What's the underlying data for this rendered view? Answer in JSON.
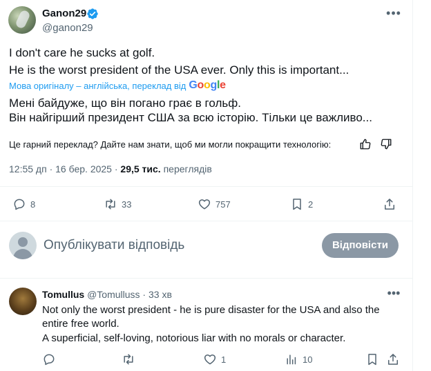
{
  "author": {
    "name": "Ganon29",
    "handle": "@ganon29",
    "verified": true
  },
  "post": {
    "original_lines": [
      "I don't care he sucks at golf.",
      "He is the worst president of the USA ever. Only this is important..."
    ],
    "translation_note": "Мова оригіналу – англійська, переклад від",
    "google_letters": [
      "G",
      "o",
      "o",
      "g",
      "l",
      "e"
    ],
    "translated_lines": [
      "Мені байдуже, що він погано грає в гольф.",
      "Він найгірший президент США за всю історію. Тільки це важливо..."
    ],
    "feedback_prompt": "Це гарний переклад? Дайте нам знати, щоб ми могли покращити технологію:",
    "time": "12:55 дп",
    "date": "16 бер. 2025",
    "views_count": "29,5 тис.",
    "views_label": "переглядів"
  },
  "actions": {
    "replies": "8",
    "reposts": "33",
    "likes": "757",
    "bookmarks": "2"
  },
  "composer": {
    "placeholder": "Опублікувати відповідь",
    "button_label": "Відповісти"
  },
  "comment": {
    "name": "Tomullus",
    "handle": "@Tomulluss",
    "time": "33 хв",
    "lines": [
      "Not only the worst president - he is pure disaster for the USA and also the",
      "entire free world.",
      "A superficial, self-loving, notorious liar with no morals or character."
    ],
    "likes": "1",
    "views": "10"
  },
  "colors": {
    "accent": "#1d9bf0",
    "muted": "#536471",
    "text": "#0f1419",
    "button_disabled": "#8b98a5"
  },
  "icons": [
    "more-icon",
    "verified-icon",
    "reply-icon",
    "repost-icon",
    "like-icon",
    "bookmark-icon",
    "share-icon",
    "views-icon",
    "thumb-up-icon",
    "thumb-down-icon"
  ]
}
